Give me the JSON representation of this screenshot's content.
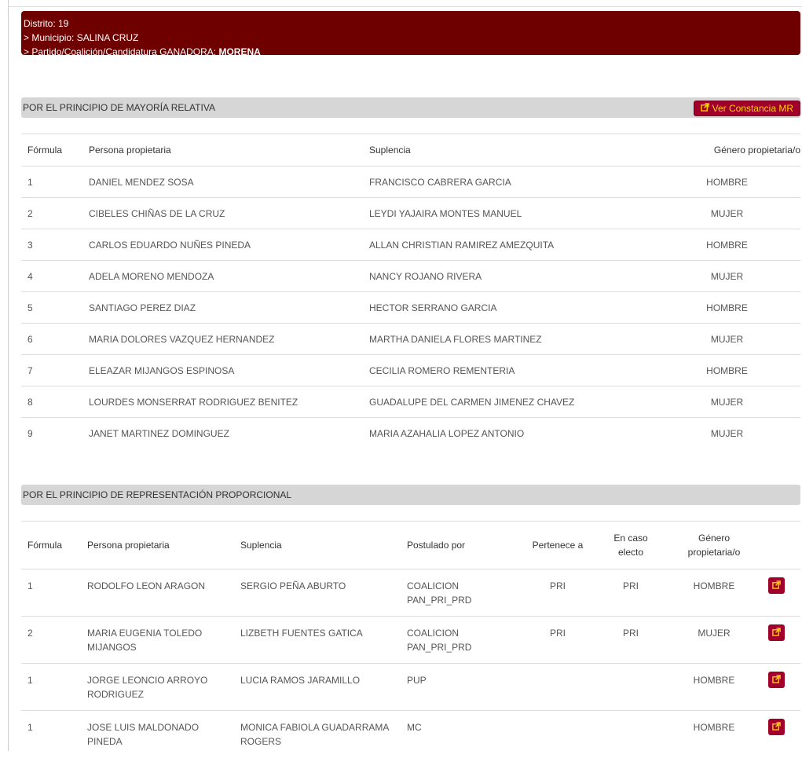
{
  "banner": {
    "line1": "Distrito: 19",
    "line2": "> Municipio: SALINA CRUZ",
    "line3_prefix": "> Partido/Coalición/Candidatura GANADORA: ",
    "line3_value": "MORENA"
  },
  "mr": {
    "title": "POR EL PRINCIPIO DE MAYORÍA RELATIVA",
    "button_label": "Ver Constancia MR",
    "columns": [
      "Fórmula",
      "Persona propietaria",
      "Suplencia",
      "Género propietaria/o"
    ],
    "rows": [
      [
        "1",
        "DANIEL MENDEZ SOSA",
        "FRANCISCO CABRERA GARCIA",
        "HOMBRE"
      ],
      [
        "2",
        "CIBELES CHIÑAS DE LA CRUZ",
        "LEYDI YAJAIRA MONTES MANUEL",
        "MUJER"
      ],
      [
        "3",
        "CARLOS EDUARDO NUÑES PINEDA",
        "ALLAN CHRISTIAN RAMIREZ AMEZQUITA",
        "HOMBRE"
      ],
      [
        "4",
        "ADELA MORENO MENDOZA",
        "NANCY ROJANO RIVERA",
        "MUJER"
      ],
      [
        "5",
        "SANTIAGO PEREZ DIAZ",
        "HECTOR SERRANO GARCIA",
        "HOMBRE"
      ],
      [
        "6",
        "MARIA DOLORES VAZQUEZ HERNANDEZ",
        "MARTHA DANIELA FLORES MARTINEZ",
        "MUJER"
      ],
      [
        "7",
        "ELEAZAR MIJANGOS ESPINOSA",
        "CECILIA ROMERO REMENTERIA",
        "HOMBRE"
      ],
      [
        "8",
        "LOURDES MONSERRAT RODRIGUEZ BENITEZ",
        "GUADALUPE DEL CARMEN JIMENEZ CHAVEZ",
        "MUJER"
      ],
      [
        "9",
        "JANET MARTINEZ DOMINGUEZ",
        "MARIA AZAHALIA LOPEZ ANTONIO",
        "MUJER"
      ]
    ]
  },
  "rp": {
    "title": "POR EL PRINCIPIO DE REPRESENTACIÓN PROPORCIONAL",
    "columns": [
      "Fórmula",
      "Persona propietaria",
      "Suplencia",
      "Postulado por",
      "Pertenece a",
      "En caso electo",
      "Género propietaria/o"
    ],
    "rows": [
      [
        "1",
        "RODOLFO LEON ARAGON",
        "SERGIO PEÑA ABURTO",
        "COALICION PAN_PRI_PRD",
        "PRI",
        "PRI",
        "HOMBRE"
      ],
      [
        "2",
        "MARIA EUGENIA TOLEDO MIJANGOS",
        "LIZBETH FUENTES GATICA",
        "COALICION PAN_PRI_PRD",
        "PRI",
        "PRI",
        "MUJER"
      ],
      [
        "1",
        "JORGE LEONCIO ARROYO RODRIGUEZ",
        "LUCIA RAMOS JARAMILLO",
        "PUP",
        "",
        "",
        "HOMBRE"
      ],
      [
        "1",
        "JOSE LUIS MALDONADO PINEDA",
        "MONICA FABIOLA GUADARRAMA ROGERS",
        "MC",
        "",
        "",
        "HOMBRE"
      ]
    ]
  },
  "colors": {
    "banner": "#6e0000",
    "button_bg": "#a0002a",
    "button_text": "#ffd400",
    "section_bar": "#d6d6d6"
  },
  "icons": {
    "external_link": "external-link-icon"
  }
}
